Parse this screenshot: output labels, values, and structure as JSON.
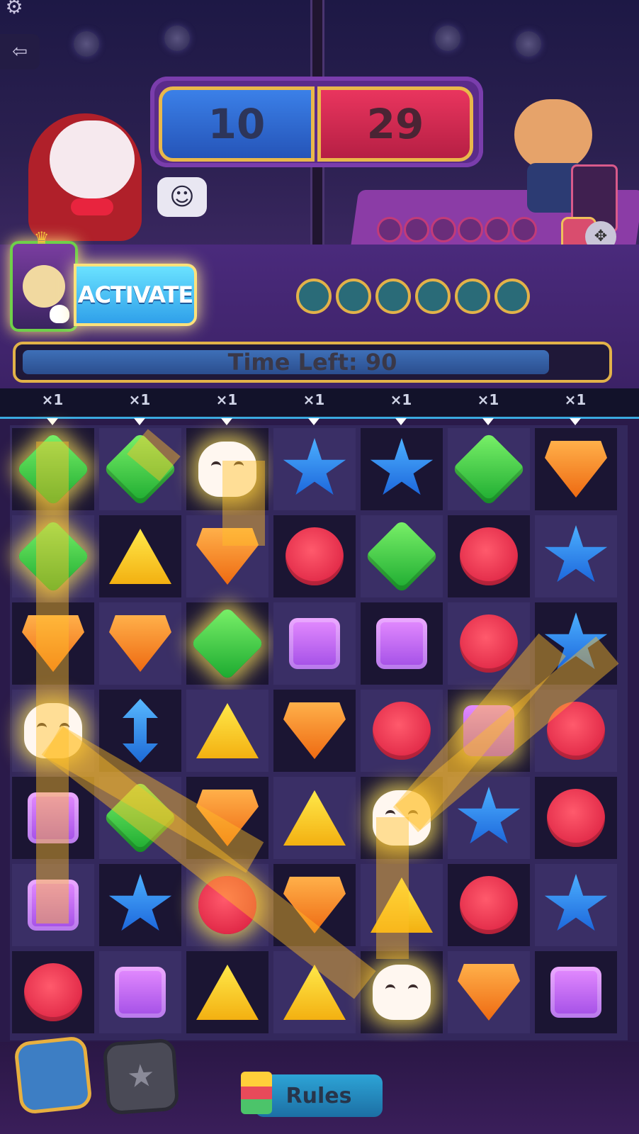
{
  "scores": {
    "player": "10",
    "opponent": "29"
  },
  "hero": {
    "activate_label": "ACTIVATE"
  },
  "timer": {
    "label": "Time Left: 90",
    "fraction": 0.9
  },
  "multipliers": [
    "×1",
    "×1",
    "×1",
    "×1",
    "×1",
    "×1",
    "×1"
  ],
  "footer": {
    "rules_label": "Rules"
  },
  "board": [
    [
      "green",
      "green",
      "skull",
      "star",
      "star",
      "green",
      "orange"
    ],
    [
      "green",
      "yellow",
      "orange",
      "red",
      "green",
      "red",
      "star"
    ],
    [
      "orange",
      "orange",
      "green",
      "purple",
      "purple",
      "red",
      "star"
    ],
    [
      "skull",
      "arrow",
      "yellow",
      "orange",
      "red",
      "purple",
      "red"
    ],
    [
      "purple",
      "green",
      "orange",
      "yellow",
      "skull",
      "star",
      "red"
    ],
    [
      "purple",
      "star",
      "red",
      "orange",
      "yellow",
      "red",
      "star"
    ],
    [
      "red",
      "purple",
      "yellow",
      "yellow",
      "skull",
      "orange",
      "purple"
    ]
  ],
  "icons": {
    "settings": "gear-icon",
    "exit": "exit-icon",
    "emote": "emote-icon",
    "scarab": "scarab-icon",
    "star_power": "star-icon",
    "rules_book": "book-icon"
  },
  "colors": {
    "player": "#2f6ad0",
    "opponent": "#d82a50",
    "accent": "#e2b249"
  }
}
